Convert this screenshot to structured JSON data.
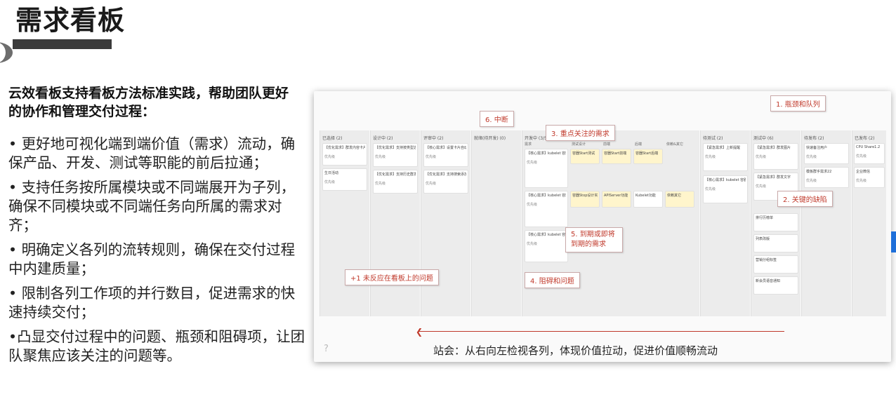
{
  "page": {
    "title": "需求看板",
    "intro": "云效看板支持看板方法标准实践，帮助团队更好的协作和管理交付过程：",
    "bullets": [
      "• 更好地可视化端到端价值（需求）流动，确保产品、开发、测试等职能的前后拉通；",
      "• 支持任务按所属模块或不同端展开为子列，确保不同模块或不同端任务向所属的需求对齐；",
      "• 明确定义各列的流转规则，确保在交付过程中内建质量；",
      "• 限制各列工作项的并行数目，促进需求的快速持续交付；",
      "•凸显交付过程中的问题、瓶颈和阻碍项，让团队聚焦应该关注的问题等。"
    ]
  },
  "screenshot": {
    "columns": [
      {
        "header": "已选择 (2)"
      },
      {
        "header": "设计中 (2)"
      },
      {
        "header": "评审中 (2)"
      },
      {
        "header": "就绪(待开发) (0)"
      },
      {
        "header": "开发中 (3/5)"
      },
      {
        "header": "待测试 (2)"
      },
      {
        "header": "测试中 (6)"
      },
      {
        "header": "待发布 (2)"
      },
      {
        "header": "已发布 (2)"
      }
    ],
    "subcolumns": [
      "需求",
      "测试设计",
      "前端",
      "后端",
      "依赖&其它"
    ],
    "cards": {
      "c1": "【优化需求】群发内容卡片",
      "c2": "生日活动",
      "c3": "【优化需求】支持按类型选择人员",
      "c4": "【优化需求】支持历史群发",
      "c5": "【核心需求】设置卡片自动推送 @11-13",
      "c6": "【优化需求】支持搜索添加人员",
      "c7": "【核心需求】kubelet 容器start",
      "c8": "容器Start测试",
      "c9": "容器Start前端",
      "c10": "容器Start后端",
      "c11": "【核心需求】kubelet 容器stop",
      "c12": "容器Stop设计实现测试用例",
      "c13": "APIServer功能",
      "c14": "Kubelet功能",
      "c15": "依赖其它",
      "c16": "【核心需求】kubelet 容器upgrade",
      "c17": "【紧急需求】上新提醒",
      "c18": "【核心需求】kubelet 容器Update @11-09",
      "c19": "【紧急需求】群发图片",
      "c20": "【紧急需求】群发文字",
      "c21": "排行历榜单",
      "c22": "列表改版",
      "c23": "营销分组标签",
      "c24": "新会员语音通知",
      "c25": "快速备注用户",
      "c26": "模板群手需求22",
      "c27": "CPU Share1.2",
      "c28": "企业微信",
      "c29": "优先级"
    },
    "callouts": {
      "a1": "1. 瓶颈和队列",
      "a2": "2. 关键的缺陷",
      "a3": "3. 重点关注的需求",
      "a4": "4. 阻碍和问题",
      "a5": "5. 到期或即将到期的需求",
      "a6": "6. 中断",
      "a7": "+1 未反应在看板上的问题"
    },
    "caption": "站会：从右向左检视各列，体现价值拉动，促进价值顺畅流动",
    "help_icon": "?"
  }
}
